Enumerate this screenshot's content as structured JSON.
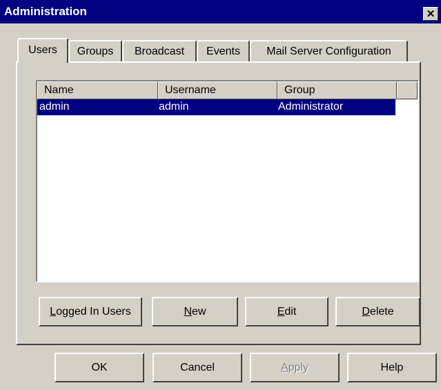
{
  "window": {
    "title": "Administration",
    "close_glyph": "✕"
  },
  "tabs": [
    {
      "label": "Users",
      "selected": true
    },
    {
      "label": "Groups",
      "selected": false
    },
    {
      "label": "Broadcast",
      "selected": false
    },
    {
      "label": "Events",
      "selected": false
    },
    {
      "label": "Mail Server Configuration",
      "selected": false
    }
  ],
  "users_table": {
    "columns": [
      "Name",
      "Username",
      "Group"
    ],
    "rows": [
      {
        "name": "admin",
        "username": "admin",
        "group": "Administrator",
        "selected": true
      }
    ]
  },
  "panel_buttons": {
    "logged_in_users": {
      "accel": "L",
      "rest": "ogged In Users"
    },
    "new": {
      "accel": "N",
      "rest": "ew"
    },
    "edit": {
      "accel": "E",
      "rest": "dit"
    },
    "delete": {
      "accel": "D",
      "rest": "elete"
    }
  },
  "dialog_buttons": {
    "ok": "OK",
    "cancel": "Cancel",
    "apply": {
      "accel": "A",
      "rest": "pply",
      "enabled": false
    },
    "help": "Help"
  },
  "colors": {
    "face": "#d4d0c8",
    "titlebar": "#000080",
    "selection": "#000080"
  }
}
